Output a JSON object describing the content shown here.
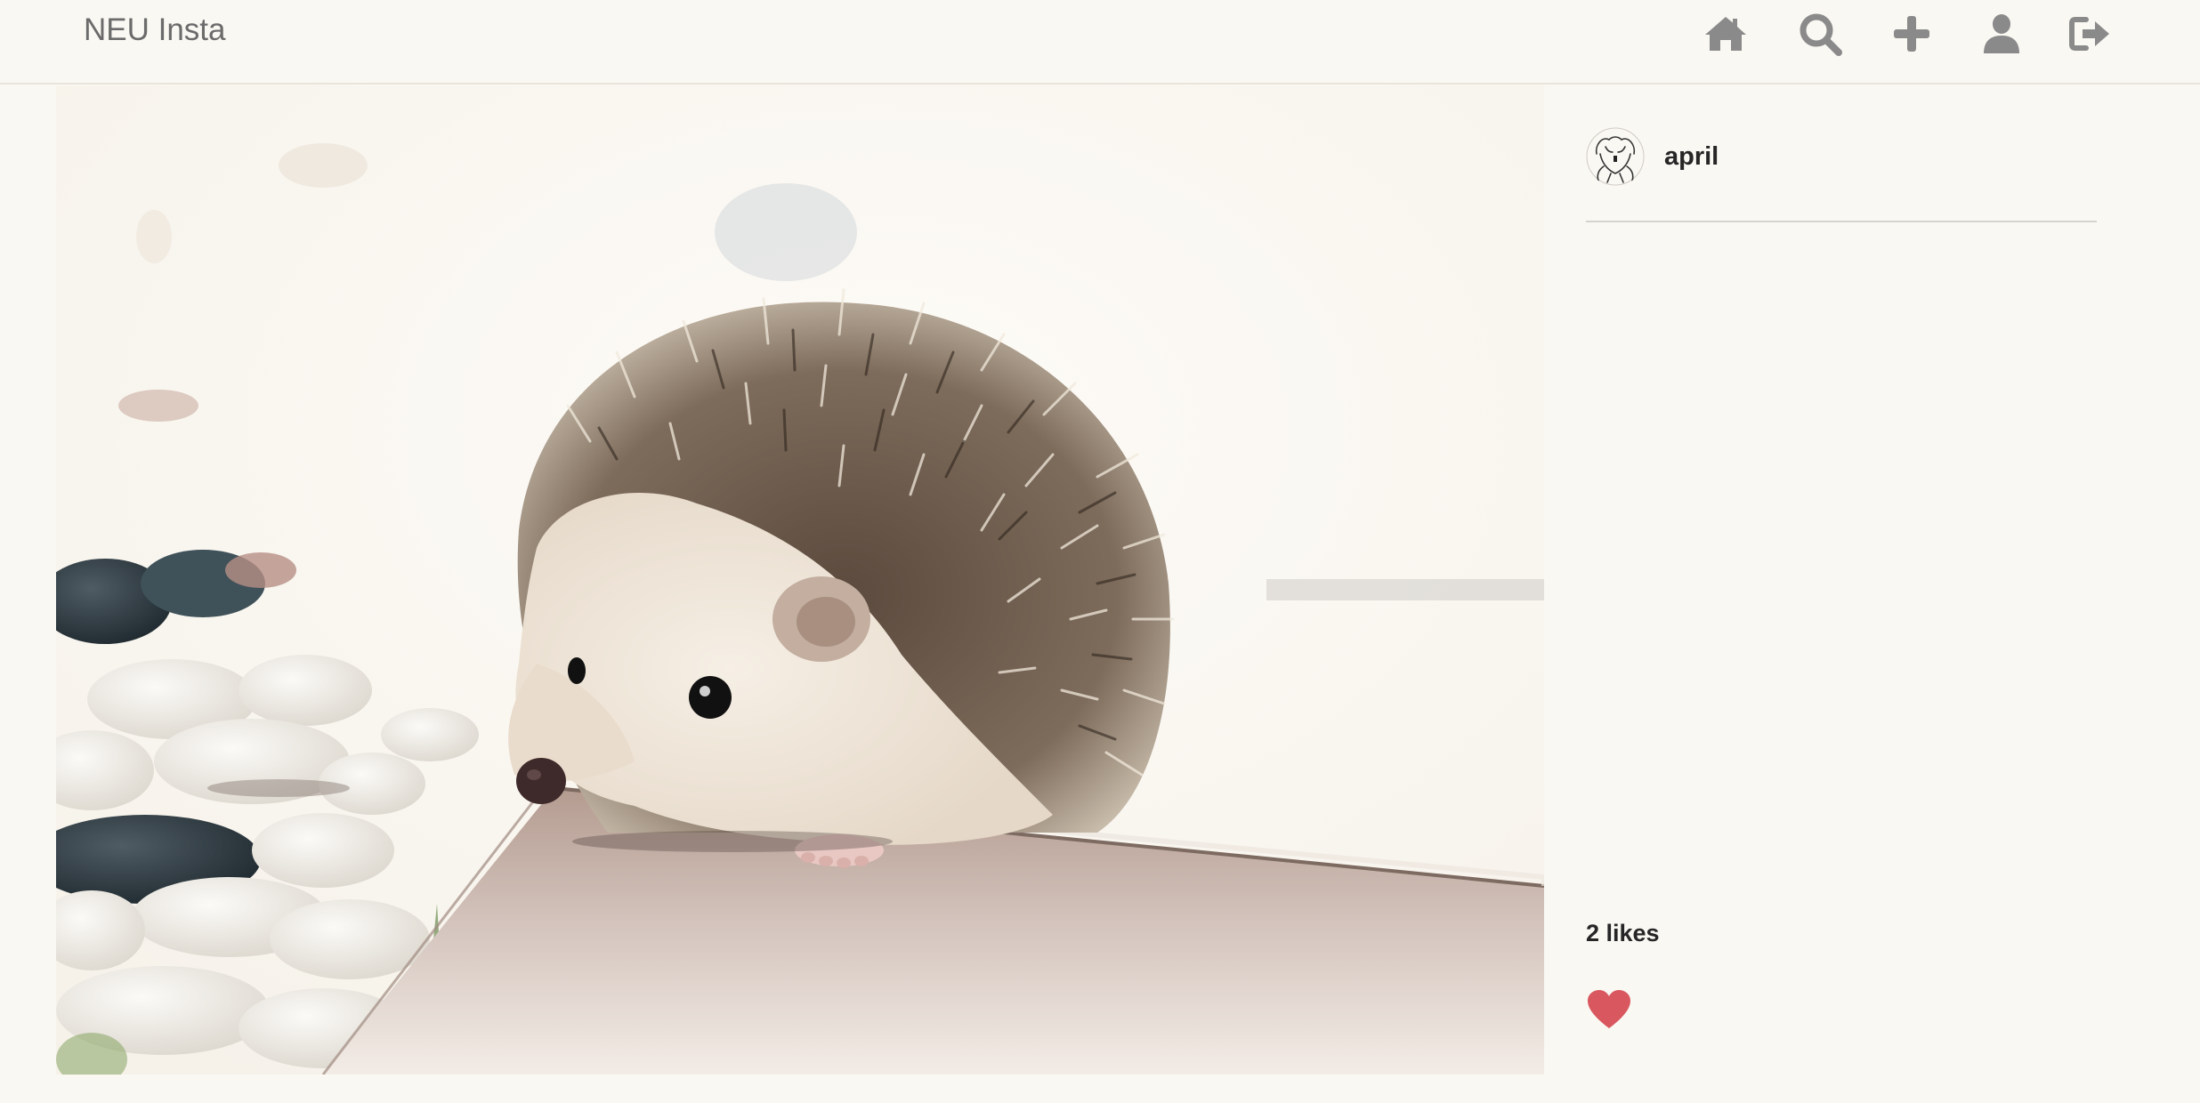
{
  "app": {
    "brand": "NEU Insta"
  },
  "nav": {
    "items": [
      {
        "icon": "home-icon"
      },
      {
        "icon": "search-icon"
      },
      {
        "icon": "plus-icon"
      },
      {
        "icon": "user-icon"
      },
      {
        "icon": "logout-icon"
      }
    ],
    "icon_color": "#8a8a8a"
  },
  "post": {
    "image_subject": "",
    "author": {
      "username": "april"
    },
    "likes_text": "2 likes",
    "liked": true,
    "heart_color": "#d9585f"
  }
}
